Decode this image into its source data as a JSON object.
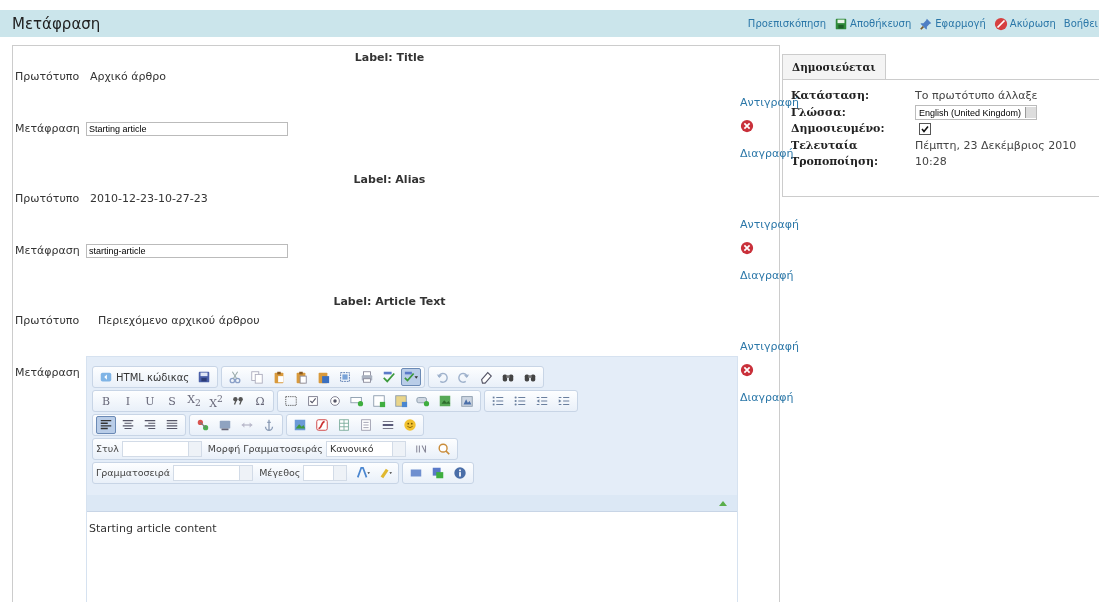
{
  "header": {
    "title": "Μετάφραση",
    "actions": [
      {
        "label": "Προεπισκόπηση",
        "kind": "preview"
      },
      {
        "label": "Αποθήκευση",
        "kind": "save"
      },
      {
        "label": "Εφαρμογή",
        "kind": "apply"
      },
      {
        "label": "Ακύρωση",
        "kind": "cancel"
      },
      {
        "label": "Βοήθει",
        "kind": "help"
      }
    ]
  },
  "fields": [
    {
      "heading": "Label: Title",
      "original_label": "Πρωτότυπο",
      "original": "Αρχικό άρθρο",
      "translation_label": "Μετάφραση",
      "kind": "text",
      "value": "Starting article",
      "copy": "Αντιγραφή",
      "delete": "Διαγραφή"
    },
    {
      "heading": "Label: Alias",
      "original_label": "Πρωτότυπο",
      "original": "2010-12-23-10-27-23",
      "translation_label": "Μετάφραση",
      "kind": "text",
      "value": "starting-article",
      "copy": "Αντιγραφή",
      "delete": "Διαγραφή"
    },
    {
      "heading": "Label: Article Text",
      "original_label": "Πρωτότυπο",
      "original": "Περιεχόμενο αρχικού άρθρου",
      "translation_label": "Μετάφραση",
      "kind": "editor",
      "copy": "Αντιγραφή",
      "delete": "Διαγραφή"
    }
  ],
  "editor": {
    "toolbar": [
      [
        [
          {
            "kind": "button",
            "label": "HTML κώδικας",
            "pressed": false
          },
          {
            "kind": "button",
            "pressed": false
          }
        ],
        [
          {
            "kind": "button",
            "pressed": false
          },
          {
            "kind": "button",
            "pressed": false
          },
          {
            "kind": "button",
            "pressed": false
          },
          {
            "kind": "button",
            "pressed": false
          },
          {
            "kind": "button",
            "pressed": false
          },
          {
            "kind": "button",
            "pressed": false
          },
          {
            "kind": "button",
            "pressed": false
          },
          {
            "kind": "button",
            "pressed": false
          },
          {
            "kind": "button",
            "pressed": true
          }
        ],
        [
          {
            "kind": "button",
            "pressed": false
          },
          {
            "kind": "button",
            "pressed": false
          },
          {
            "kind": "button",
            "pressed": false
          },
          {
            "kind": "button",
            "pressed": false
          },
          {
            "kind": "button",
            "pressed": false
          }
        ]
      ],
      [
        [
          {
            "kind": "button",
            "label": "B",
            "pressed": false
          },
          {
            "kind": "button",
            "label": "I",
            "pressed": false
          },
          {
            "kind": "button",
            "label": "U",
            "pressed": false
          },
          {
            "kind": "button",
            "label": "S",
            "pressed": false
          },
          {
            "kind": "button",
            "label": "X$_{2}$",
            "pressed": false
          },
          {
            "kind": "button",
            "label": "X$^{2}$",
            "pressed": false
          },
          {
            "kind": "button",
            "pressed": false
          },
          {
            "kind": "button",
            "label": "Ω",
            "pressed": false
          }
        ],
        [
          {
            "kind": "button",
            "pressed": false
          },
          {
            "kind": "button",
            "pressed": false
          },
          {
            "kind": "button",
            "pressed": false
          },
          {
            "kind": "button",
            "pressed": false
          },
          {
            "kind": "button",
            "pressed": false
          },
          {
            "kind": "button",
            "pressed": false
          },
          {
            "kind": "button",
            "pressed": false
          },
          {
            "kind": "button",
            "pressed": false
          },
          {
            "kind": "button",
            "pressed": false
          }
        ],
        [
          {
            "kind": "button",
            "pressed": false
          },
          {
            "kind": "button",
            "pressed": false
          },
          {
            "kind": "button",
            "pressed": false
          },
          {
            "kind": "button",
            "pressed": false
          }
        ]
      ],
      [
        [
          {
            "kind": "button",
            "pressed": true
          },
          {
            "kind": "button",
            "pressed": false
          },
          {
            "kind": "button",
            "pressed": false
          },
          {
            "kind": "button",
            "pressed": false
          }
        ],
        [
          {
            "kind": "button",
            "pressed": false
          },
          {
            "kind": "button",
            "pressed": false
          },
          {
            "kind": "button",
            "pressed": false
          },
          {
            "kind": "button",
            "pressed": false
          }
        ],
        [
          {
            "kind": "button",
            "pressed": false
          },
          {
            "kind": "button",
            "pressed": false
          },
          {
            "kind": "button",
            "pressed": false
          },
          {
            "kind": "button",
            "pressed": false
          },
          {
            "kind": "button",
            "pressed": false
          },
          {
            "kind": "button",
            "pressed": false
          }
        ]
      ],
      [
        [
          {
            "kind": "combo",
            "label": "Στυλ"
          },
          {
            "kind": "combo",
            "label": "Μορφή Γραμματοσειράς",
            "value": "Κανονικό"
          },
          {
            "kind": "button",
            "pressed": false
          },
          {
            "kind": "button",
            "pressed": false
          }
        ]
      ],
      [
        [
          {
            "kind": "combo",
            "label": "Γραμματοσειρά"
          },
          {
            "kind": "combo",
            "label": "Μέγεθος",
            "narrow": true
          },
          {
            "kind": "button",
            "pressed": false
          },
          {
            "kind": "button",
            "pressed": false
          }
        ],
        [
          {
            "kind": "button",
            "pressed": false
          },
          {
            "kind": "button",
            "pressed": false
          },
          {
            "kind": "button",
            "pressed": false
          }
        ]
      ]
    ],
    "content": "Starting article content"
  },
  "sidebar": {
    "tab": {
      "label": "Δημοσιεύεται",
      "selected": true
    },
    "rows": [
      {
        "label": "Κατάσταση:",
        "kind": "text",
        "value": "Το πρωτότυπο άλλαξε"
      },
      {
        "label": "Γλώσσα:",
        "kind": "select",
        "value": "English (United Kingdom)"
      },
      {
        "label": "Δημοσιευμένο:",
        "kind": "checkbox",
        "checked": true
      },
      {
        "label": "Τελευταία Τροποποίηση:",
        "kind": "text",
        "value": "Πέμπτη, 23 Δεκέμβριος 2010 10:28"
      }
    ]
  }
}
